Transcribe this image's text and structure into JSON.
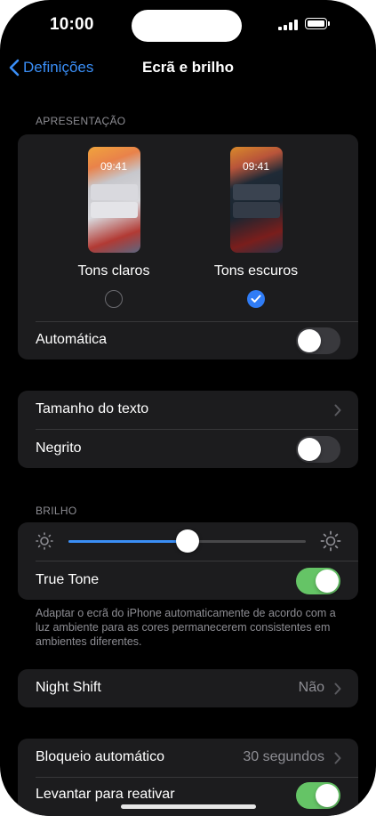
{
  "status": {
    "time": "10:00"
  },
  "nav": {
    "back_label": "Definições",
    "title": "Ecrã e brilho"
  },
  "appearance": {
    "header": "APRESENTAÇÃO",
    "options": [
      {
        "label": "Tons claros",
        "preview_time": "09:41",
        "selected": false
      },
      {
        "label": "Tons escuros",
        "preview_time": "09:41",
        "selected": true
      }
    ],
    "automatic": {
      "label": "Automática",
      "on": false
    }
  },
  "text": {
    "text_size_label": "Tamanho do texto",
    "bold_label": "Negrito",
    "bold_on": false
  },
  "brightness": {
    "header": "BRILHO",
    "level": 0.5,
    "true_tone_label": "True Tone",
    "true_tone_on": true,
    "footnote": "Adaptar o ecrã do iPhone automaticamente de acordo com a luz ambiente para as cores permanecerem consistentes em ambientes diferentes."
  },
  "night_shift": {
    "label": "Night Shift",
    "value": "Não"
  },
  "lock": {
    "auto_lock_label": "Bloqueio automático",
    "auto_lock_value": "30 segundos",
    "raise_to_wake_label": "Levantar para reativar",
    "raise_to_wake_on": true
  },
  "colors": {
    "accent": "#3a8ef6",
    "toggle_on": "#65c466",
    "group_bg": "#1c1c1e"
  },
  "icons": [
    "chevron-left-icon",
    "chevron-right-icon",
    "checkmark-icon",
    "sun-small-icon",
    "sun-large-icon",
    "signal-icon",
    "battery-icon"
  ]
}
